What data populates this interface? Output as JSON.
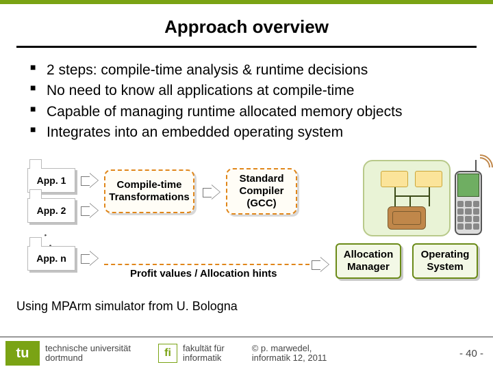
{
  "title": "Approach overview",
  "bullets": [
    "2 steps: compile-time analysis & runtime decisions",
    "No need to know all applications at compile-time",
    "Capable of managing runtime allocated memory objects",
    "Integrates into an embedded operating system"
  ],
  "apps": {
    "a1": "App. 1",
    "a2": "App. 2",
    "an": "App. n"
  },
  "boxes": {
    "ctt": "Compile-time\nTransformations",
    "gcc": "Standard\nCompiler\n(GCC)",
    "alloc": "Allocation\nManager",
    "os": "Operating\nSystem"
  },
  "profit": "Profit values / Allocation hints",
  "using": "Using MPArm simulator from U. Bologna",
  "footer": {
    "tu": "tu",
    "uni1": "technische universität",
    "uni2": "dortmund",
    "fi": "fi",
    "fak1": "fakultät für",
    "fak2": "informatik",
    "cr1": "©  p. marwedel,",
    "cr2": "informatik 12,  2011",
    "page": "-  40 -"
  }
}
